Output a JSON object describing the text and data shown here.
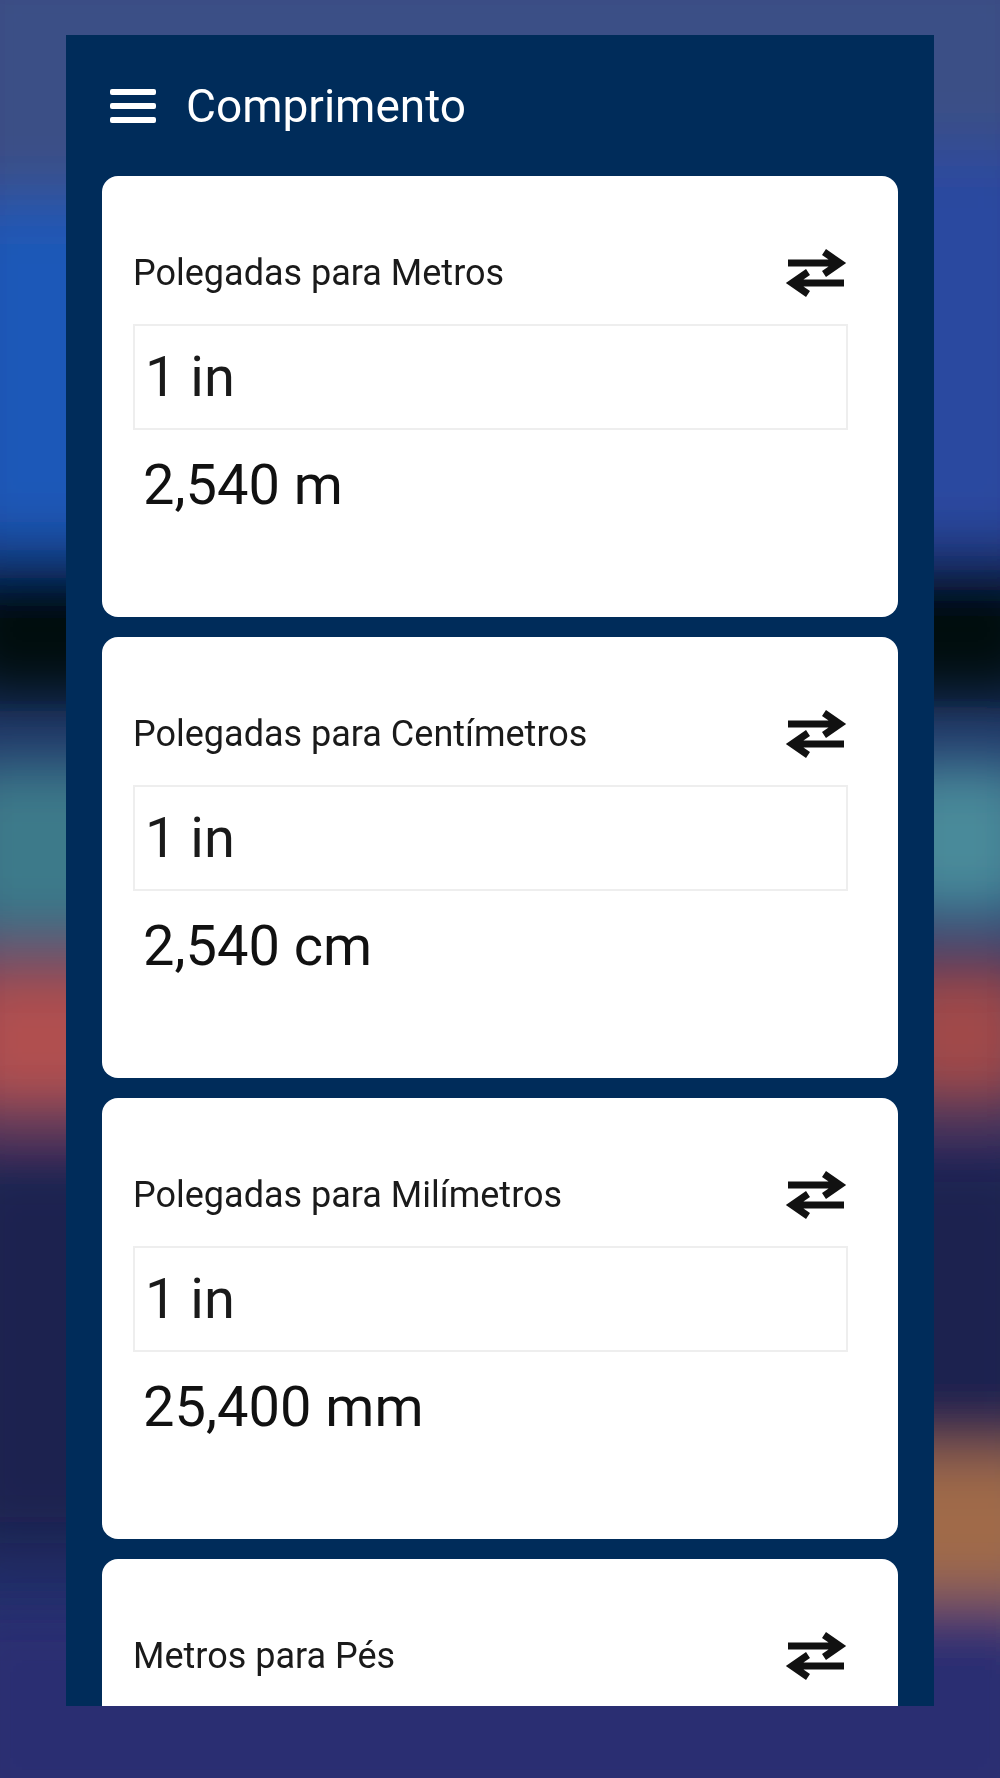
{
  "app_bar": {
    "title": "Comprimento"
  },
  "cards": [
    {
      "title": "Polegadas para Metros",
      "input": "1 in",
      "result": "2,540 m"
    },
    {
      "title": "Polegadas para Centímetros",
      "input": "1 in",
      "result": "2,540 cm"
    },
    {
      "title": "Polegadas para Milímetros",
      "input": "1 in",
      "result": "25,400 mm"
    },
    {
      "title": "Metros para Pés"
    }
  ]
}
